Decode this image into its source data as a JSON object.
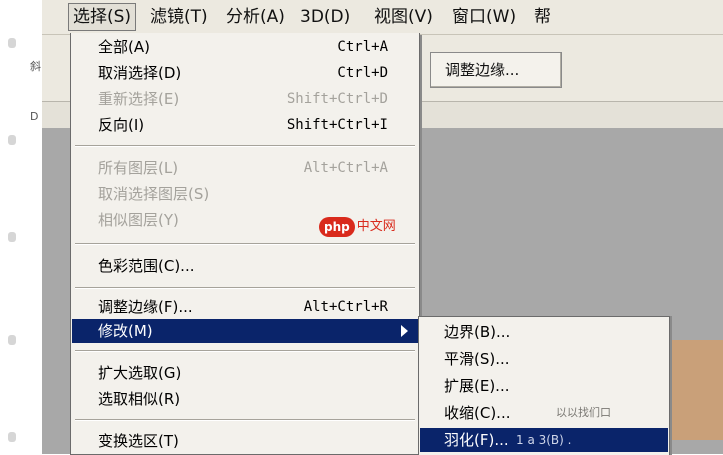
{
  "menubar": {
    "items": [
      "选择(S)",
      "滤镜(T)",
      "分析(A)",
      "3D(D)",
      "视图(V)",
      "窗口(W)",
      "帮"
    ]
  },
  "left_strip_text": [
    "斜",
    "D"
  ],
  "options": {
    "refine_edge_button": "调整边缘..."
  },
  "dropdown": {
    "items": [
      {
        "label": "全部(A)",
        "shortcut": "Ctrl+A"
      },
      {
        "label": "取消选择(D)",
        "shortcut": "Ctrl+D"
      },
      {
        "label": "重新选择(E)",
        "shortcut": "Shift+Ctrl+D"
      },
      {
        "label": "反向(I)",
        "shortcut": "Shift+Ctrl+I"
      },
      {
        "label": "所有图层(L)",
        "shortcut": "Alt+Ctrl+A"
      },
      {
        "label": "取消选择图层(S)",
        "shortcut": ""
      },
      {
        "label": "相似图层(Y)",
        "shortcut": ""
      },
      {
        "label": "色彩范围(C)...",
        "shortcut": ""
      },
      {
        "label": "调整边缘(F)...",
        "shortcut": "Alt+Ctrl+R"
      },
      {
        "label": "修改(M)",
        "shortcut": ""
      },
      {
        "label": "扩大选取(G)",
        "shortcut": ""
      },
      {
        "label": "选取相似(R)",
        "shortcut": ""
      },
      {
        "label": "变换选区(T)",
        "shortcut": ""
      }
    ]
  },
  "watermark": {
    "logo": "php",
    "text": "中文网"
  },
  "submenu": {
    "items": [
      {
        "label": "边界(B)..."
      },
      {
        "label": "平滑(S)..."
      },
      {
        "label": "扩展(E)..."
      },
      {
        "label": "收缩(C)..."
      },
      {
        "label": "羽化(F)..."
      }
    ],
    "shrink_extra": "以以找们口",
    "feather_extra": "1 a 3(B)  ."
  }
}
